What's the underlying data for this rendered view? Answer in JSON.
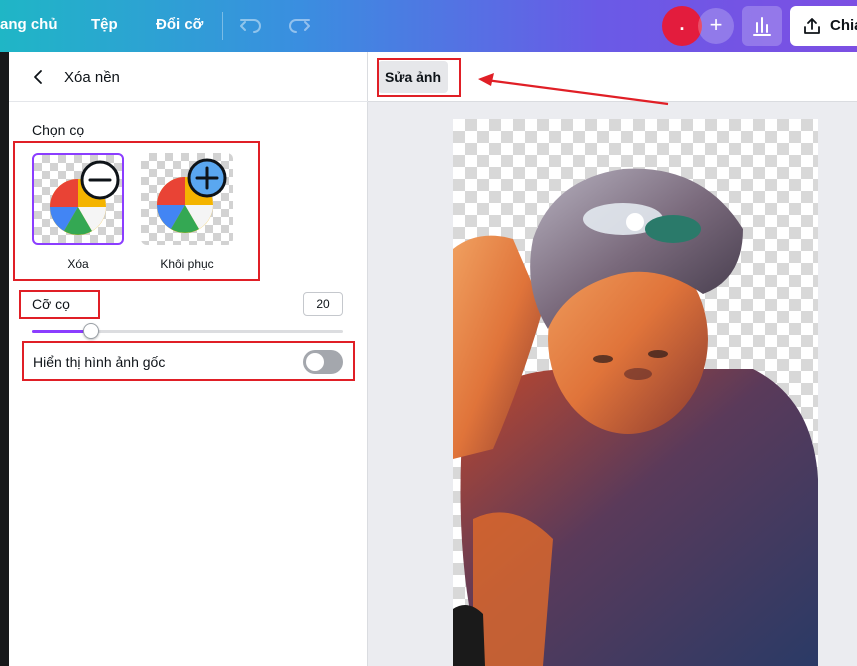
{
  "topbar": {
    "nav_home": "ang chủ",
    "nav_file": "Tệp",
    "nav_resize": "Đổi cỡ",
    "avatar_text": ".",
    "share_label": "Chia",
    "avatar_color": "#e31c3d",
    "gradient": [
      "#1fb6c6",
      "#7c4fe3"
    ]
  },
  "panel": {
    "title": "Xóa nền",
    "brush_section_label": "Chọn cọ",
    "brushes": [
      {
        "label": "Xóa",
        "selected": true,
        "icon": "minus-icon"
      },
      {
        "label": "Khôi phục",
        "selected": false,
        "icon": "plus-icon"
      }
    ],
    "brush_size_label": "Cỡ cọ",
    "brush_size_value": "20",
    "brush_size_fraction": 0.19,
    "show_original_label": "Hiển thị hình ảnh gốc",
    "show_original_on": false,
    "accent_color": "#8b3dff"
  },
  "canvas": {
    "edit_button_label": "Sửa ảnh"
  },
  "annotation_color": "#e01f26"
}
